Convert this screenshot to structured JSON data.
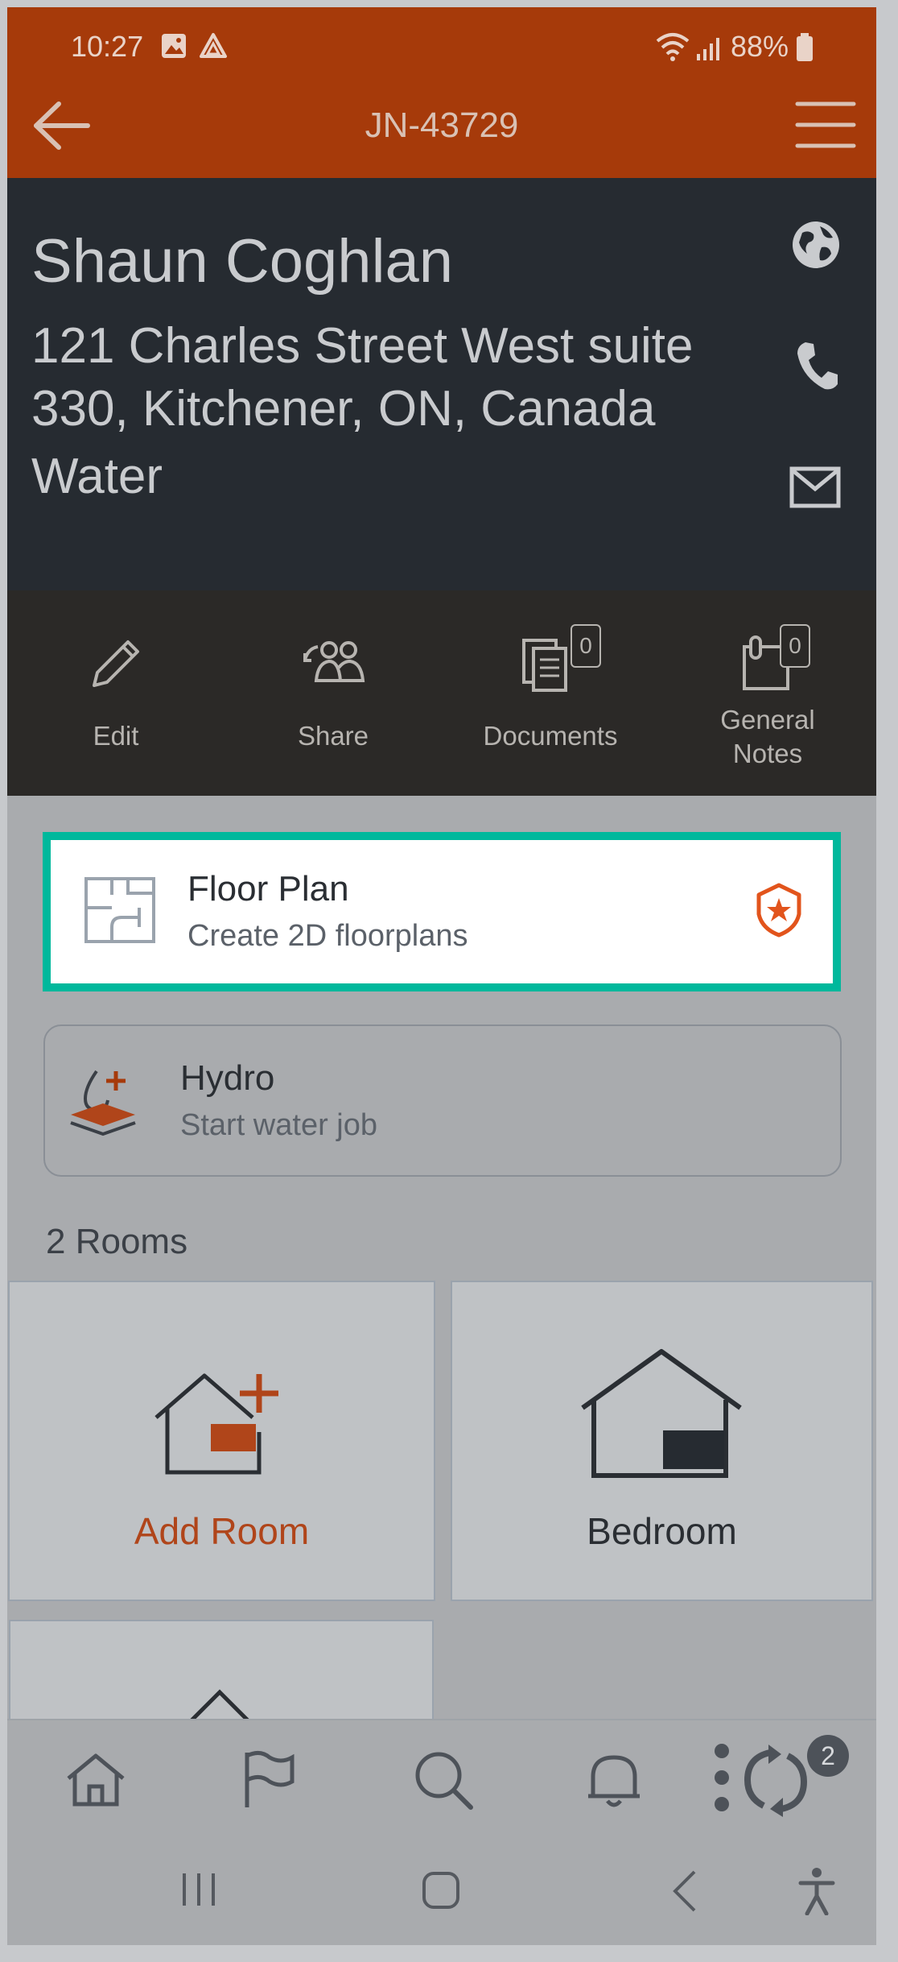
{
  "status_bar": {
    "time": "10:27",
    "battery": "88%"
  },
  "header": {
    "job_id": "JN-43729"
  },
  "contact": {
    "name": "Shaun Coghlan",
    "address": "121 Charles Street West suite 330, Kitchener, ON, Canada",
    "service": "Water"
  },
  "actions": [
    {
      "label": "Edit",
      "icon": "pencil-icon"
    },
    {
      "label": "Share",
      "icon": "share-users-icon"
    },
    {
      "label": "Documents",
      "icon": "documents-icon",
      "badge": "0"
    },
    {
      "label": "General Notes",
      "icon": "notes-icon",
      "badge": "0"
    }
  ],
  "floor_plan": {
    "title": "Floor Plan",
    "subtitle": "Create 2D floorplans",
    "highlight_color": "#00b89c"
  },
  "hydro": {
    "title": "Hydro",
    "subtitle": "Start water job"
  },
  "rooms": {
    "count_label": "2 Rooms",
    "tiles": [
      {
        "label": "Add Room",
        "icon": "add-room-icon"
      },
      {
        "label": "Bedroom",
        "icon": "house-icon"
      }
    ]
  },
  "bottom_nav": {
    "items": [
      "home-icon",
      "flag-icon",
      "search-icon",
      "bell-icon",
      "sync-icon"
    ],
    "sync_badge": "2"
  },
  "colors": {
    "accent": "#a63a0a",
    "header_bg": "#262b31",
    "action_bg": "#2b2927"
  }
}
